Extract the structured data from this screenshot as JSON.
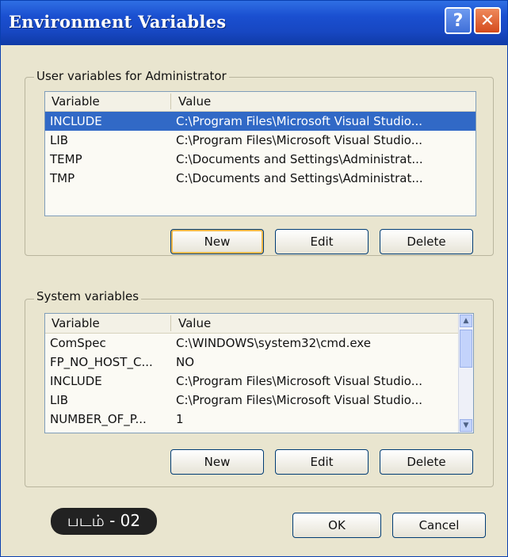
{
  "window": {
    "title": "Environment Variables",
    "help_glyph": "?",
    "close_glyph": "✕"
  },
  "user_vars": {
    "group_label": "User variables for Administrator",
    "columns": [
      "Variable",
      "Value"
    ],
    "rows": [
      {
        "name": "INCLUDE",
        "value": "C:\\Program Files\\Microsoft Visual Studio...",
        "selected": true
      },
      {
        "name": "LIB",
        "value": "C:\\Program Files\\Microsoft Visual Studio..."
      },
      {
        "name": "TEMP",
        "value": "C:\\Documents and Settings\\Administrat..."
      },
      {
        "name": "TMP",
        "value": "C:\\Documents and Settings\\Administrat..."
      }
    ],
    "buttons": {
      "new": "New",
      "edit": "Edit",
      "delete": "Delete"
    }
  },
  "system_vars": {
    "group_label": "System variables",
    "columns": [
      "Variable",
      "Value"
    ],
    "rows": [
      {
        "name": "ComSpec",
        "value": "C:\\WINDOWS\\system32\\cmd.exe"
      },
      {
        "name": "FP_NO_HOST_C...",
        "value": "NO"
      },
      {
        "name": "INCLUDE",
        "value": "C:\\Program Files\\Microsoft Visual Studio..."
      },
      {
        "name": "LIB",
        "value": "C:\\Program Files\\Microsoft Visual Studio..."
      },
      {
        "name": "NUMBER_OF_P...",
        "value": "1"
      }
    ],
    "buttons": {
      "new": "New",
      "edit": "Edit",
      "delete": "Delete"
    }
  },
  "footer": {
    "ok": "OK",
    "cancel": "Cancel",
    "figure_badge": "படம் - 02"
  },
  "colors": {
    "title_bar": "#1a4fd0",
    "selection": "#3169c6",
    "dialog_bg": "#e9e5cf"
  }
}
